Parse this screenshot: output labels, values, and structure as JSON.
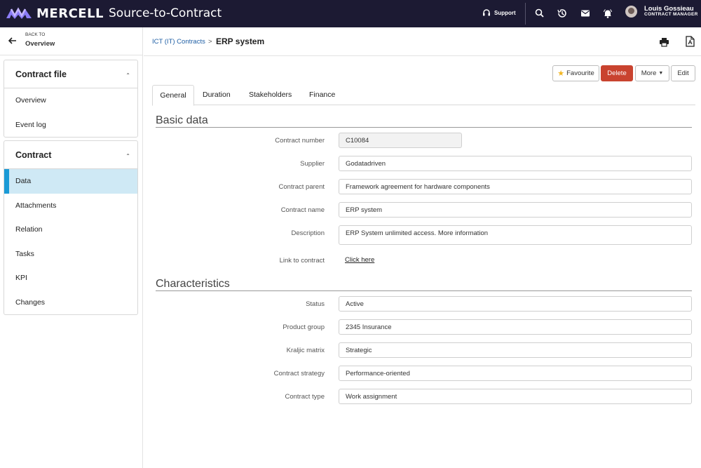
{
  "brand": {
    "name": "MERCELL",
    "product": "Source-to-Contract"
  },
  "topbar": {
    "support_label": "Support",
    "user_name": "Louis Gossieau",
    "user_role": "CONTRACT MANAGER"
  },
  "sidebar": {
    "back_small": "BACK TO",
    "back_label": "Overview",
    "panels": [
      {
        "title": "Contract file",
        "items": [
          "Overview",
          "Event log"
        ]
      },
      {
        "title": "Contract",
        "items": [
          "Data",
          "Attachments",
          "Relation",
          "Tasks",
          "KPI",
          "Changes"
        ],
        "active": "Data"
      }
    ]
  },
  "breadcrumb": {
    "parent": "ICT (IT) Contracts",
    "separator": ">",
    "current": "ERP system"
  },
  "actions": {
    "favourite": "Favourite",
    "delete": "Delete",
    "more": "More",
    "edit": "Edit"
  },
  "tabs": [
    "General",
    "Duration",
    "Stakeholders",
    "Finance"
  ],
  "basic_data": {
    "title": "Basic data",
    "contract_number": {
      "label": "Contract number",
      "value": "C10084"
    },
    "supplier": {
      "label": "Supplier",
      "value": "Godatadriven"
    },
    "contract_parent": {
      "label": "Contract parent",
      "value": "Framework agreement for hardware components"
    },
    "contract_name": {
      "label": "Contract name",
      "value": "ERP system"
    },
    "description": {
      "label": "Description",
      "value": "ERP System unlimited access. More information"
    },
    "link": {
      "label": "Link to contract",
      "value": "Click here"
    }
  },
  "characteristics": {
    "title": "Characteristics",
    "status": {
      "label": "Status",
      "value": "Active"
    },
    "product_group": {
      "label": "Product group",
      "value": "2345 Insurance"
    },
    "kraljic": {
      "label": "Kraljic matrix",
      "value": "Strategic"
    },
    "strategy": {
      "label": "Contract strategy",
      "value": "Performance-oriented"
    },
    "type": {
      "label": "Contract type",
      "value": "Work assignment"
    }
  },
  "colors": {
    "topbar": "#1c1a33",
    "accent": "#1a9ad6",
    "active_bg": "#cfe9f5",
    "delete": "#c9432f",
    "star": "#f2b521"
  }
}
